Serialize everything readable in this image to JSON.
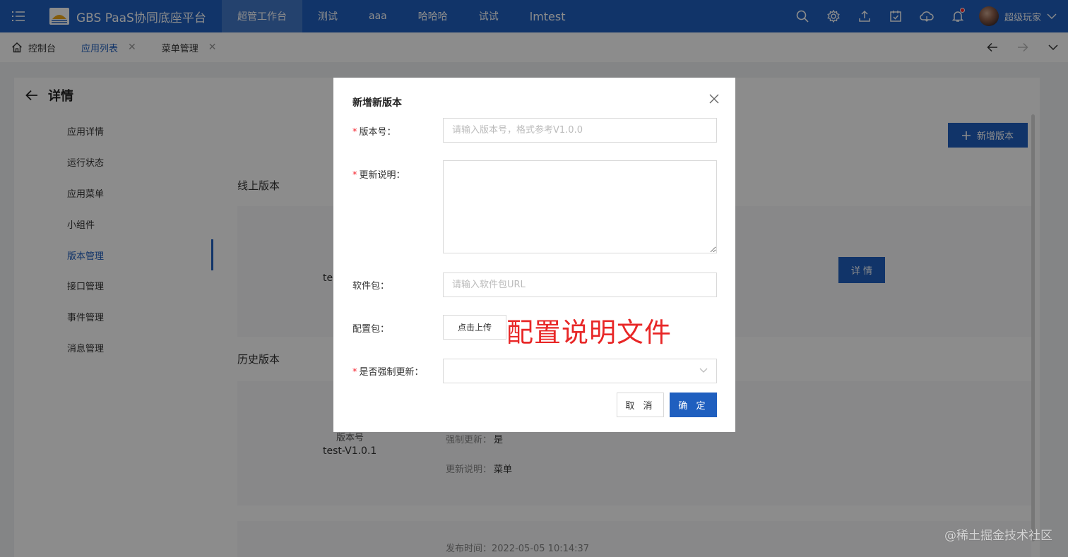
{
  "app": {
    "title": "GBS PaaS协同底座平台"
  },
  "nav": {
    "items": [
      "超管工作台",
      "测试",
      "aaa",
      "哈哈哈",
      "试试",
      "lmtest"
    ]
  },
  "user": {
    "name": "超级玩家"
  },
  "tabs": {
    "home": "控制台",
    "items": [
      "应用列表",
      "菜单管理"
    ]
  },
  "page": {
    "title": "详情",
    "side_menu": [
      "应用详情",
      "运行状态",
      "应用菜单",
      "小组件",
      "版本管理",
      "接口管理",
      "事件管理",
      "消息管理"
    ],
    "add_version_label": "新增版本",
    "online_section": "线上版本",
    "online_partial_text": "te",
    "detail_button": "详 情",
    "history_section": "历史版本",
    "history": {
      "version_label": "版本号",
      "version_value": "test-V1.0.1",
      "force_update_label": "强制更新：",
      "force_update_value": "是",
      "update_desc_label": "更新说明：",
      "update_desc_value": "菜单",
      "publish_time_partial": "发布时间：2022-05-05 10:14:37"
    }
  },
  "modal": {
    "title": "新增新版本",
    "fields": {
      "version": {
        "label": "版本号：",
        "placeholder": "请输入版本号，格式参考V1.0.0",
        "required": true
      },
      "description": {
        "label": "更新说明：",
        "required": true
      },
      "package": {
        "label": "软件包：",
        "placeholder": "请输入软件包URL"
      },
      "config": {
        "label": "配置包：",
        "button": "点击上传"
      },
      "force": {
        "label": "是否强制更新：",
        "required": true
      }
    },
    "annotation": "配置说明文件",
    "cancel": "取 消",
    "confirm": "确 定"
  },
  "watermark": "@稀土掘金技术社区",
  "colors": {
    "primary": "#1f5fbf",
    "danger": "#f5222d",
    "annotation": "#e82727"
  },
  "icons": [
    "menu-icon",
    "logo-icon",
    "search-icon",
    "gear-icon",
    "upload-icon",
    "calendar-check-icon",
    "cloud-icon",
    "bell-icon",
    "chevron-down-icon",
    "home-icon",
    "close-icon",
    "arrow-left-icon",
    "arrow-right-icon",
    "plus-icon"
  ]
}
